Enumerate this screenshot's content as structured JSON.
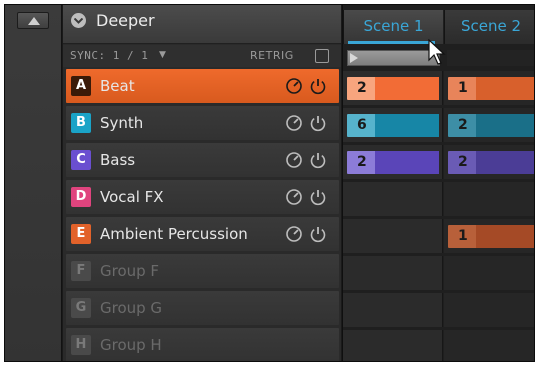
{
  "project": {
    "name": "Deeper",
    "icon": "chevron-down-icon"
  },
  "sync": {
    "label": "SYNC: 1 / 1",
    "retrig_label": "RETRIG",
    "retrig_checked": false
  },
  "groups": [
    {
      "letter": "A",
      "name": "Beat",
      "color": "#ef6a2c",
      "selected": true,
      "empty": false
    },
    {
      "letter": "B",
      "name": "Synth",
      "color": "#1aa3c7",
      "selected": false,
      "empty": false
    },
    {
      "letter": "C",
      "name": "Bass",
      "color": "#6a4fd0",
      "selected": false,
      "empty": false
    },
    {
      "letter": "D",
      "name": "Vocal FX",
      "color": "#e0447e",
      "selected": false,
      "empty": false
    },
    {
      "letter": "E",
      "name": "Ambient Percussion",
      "color": "#e2622a",
      "selected": false,
      "empty": false
    },
    {
      "letter": "F",
      "name": "Group F",
      "color": "#4a4a4a",
      "selected": false,
      "empty": true
    },
    {
      "letter": "G",
      "name": "Group G",
      "color": "#4a4a4a",
      "selected": false,
      "empty": true
    },
    {
      "letter": "H",
      "name": "Group H",
      "color": "#4a4a4a",
      "selected": false,
      "empty": true
    }
  ],
  "scenes": [
    {
      "label": "Scene 1",
      "active": true,
      "clips": [
        {
          "row": 0,
          "pattern": "2",
          "color": "#f26c36",
          "light": "#f8a57e"
        },
        {
          "row": 1,
          "pattern": "6",
          "color": "#1786a6",
          "light": "#56b3cc"
        },
        {
          "row": 2,
          "pattern": "2",
          "color": "#5a45b8",
          "light": "#8c7cd8"
        }
      ]
    },
    {
      "label": "Scene 2",
      "active": false,
      "clips": [
        {
          "row": 0,
          "pattern": "1",
          "color": "#d8602c",
          "light": "#e8845a"
        },
        {
          "row": 1,
          "pattern": "2",
          "color": "#1a6f88",
          "light": "#3d8ea6"
        },
        {
          "row": 2,
          "pattern": "2",
          "color": "#4b3d96",
          "light": "#6a5bb5"
        },
        {
          "row": 4,
          "pattern": "1",
          "color": "#a54a26",
          "light": "#b8603a"
        }
      ]
    }
  ],
  "colors": {
    "accent": "#3aa6d6",
    "selected_group": "#ef6a2c"
  }
}
